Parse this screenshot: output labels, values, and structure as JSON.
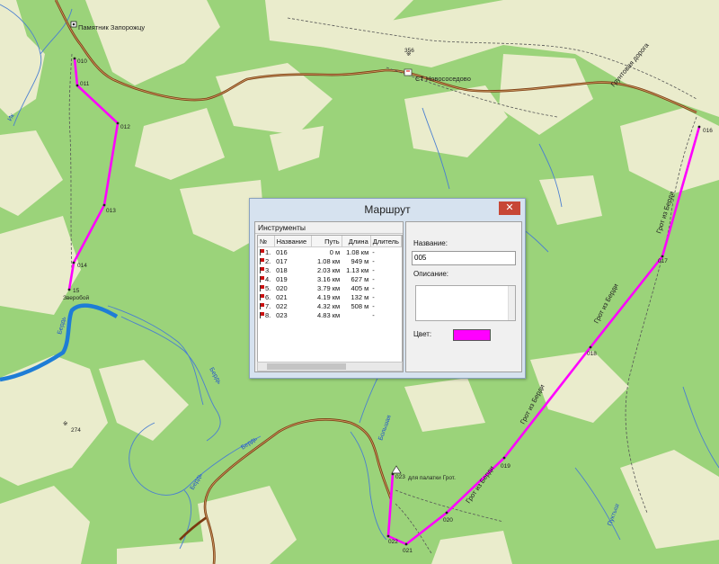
{
  "map": {
    "places": {
      "monument": "Памятник Запорожцу",
      "village": "СТ Новососедово",
      "zverobay": "Зверобой",
      "tent_place": "для палатки Грот.",
      "height_356": "356",
      "height_274": "274"
    },
    "roads": {
      "grotto_road": "Грот из Берди",
      "detour_road": "Грот из Берди",
      "forest_road": "Грунтовая дорога"
    },
    "rivers": {
      "berd_1": "Бердь",
      "berd_2": "Бердь",
      "berd_3": "Бердь",
      "berd_4": "Бердь",
      "bolshaya": "Большая",
      "puktysh": "Пуктыш",
      "ik": "Ик"
    },
    "waypoints": [
      "010",
      "011",
      "012",
      "013",
      "014",
      "15",
      "016",
      "017",
      "018",
      "019",
      "020",
      "021",
      "022",
      "023"
    ],
    "route_color": "#ff00ff",
    "river_color": "#1e7dd6",
    "road_color": "#8b4513"
  },
  "dialog": {
    "title": "Маршрут",
    "close_label": "✕",
    "tools_header": "Инструменты",
    "columns": [
      "№",
      "Название",
      "Путь",
      "Длина",
      "Длитель"
    ],
    "rows": [
      {
        "n": "1.",
        "name": "016",
        "path": "0 м",
        "length": "1.08 км",
        "dur": "-"
      },
      {
        "n": "2.",
        "name": "017",
        "path": "1.08 км",
        "length": "949 м",
        "dur": "-"
      },
      {
        "n": "3.",
        "name": "018",
        "path": "2.03 км",
        "length": "1.13 км",
        "dur": "-"
      },
      {
        "n": "4.",
        "name": "019",
        "path": "3.16 км",
        "length": "627 м",
        "dur": "-"
      },
      {
        "n": "5.",
        "name": "020",
        "path": "3.79 км",
        "length": "405 м",
        "dur": "-"
      },
      {
        "n": "6.",
        "name": "021",
        "path": "4.19 км",
        "length": "132 м",
        "dur": "-"
      },
      {
        "n": "7.",
        "name": "022",
        "path": "4.32 км",
        "length": "508 м",
        "dur": "-"
      },
      {
        "n": "8.",
        "name": "023",
        "path": "4.83 км",
        "length": "",
        "dur": "-"
      }
    ],
    "name_label": "Название:",
    "name_value": "005",
    "desc_label": "Описание:",
    "color_label": "Цвет:",
    "color_value": "#ff00ff"
  }
}
